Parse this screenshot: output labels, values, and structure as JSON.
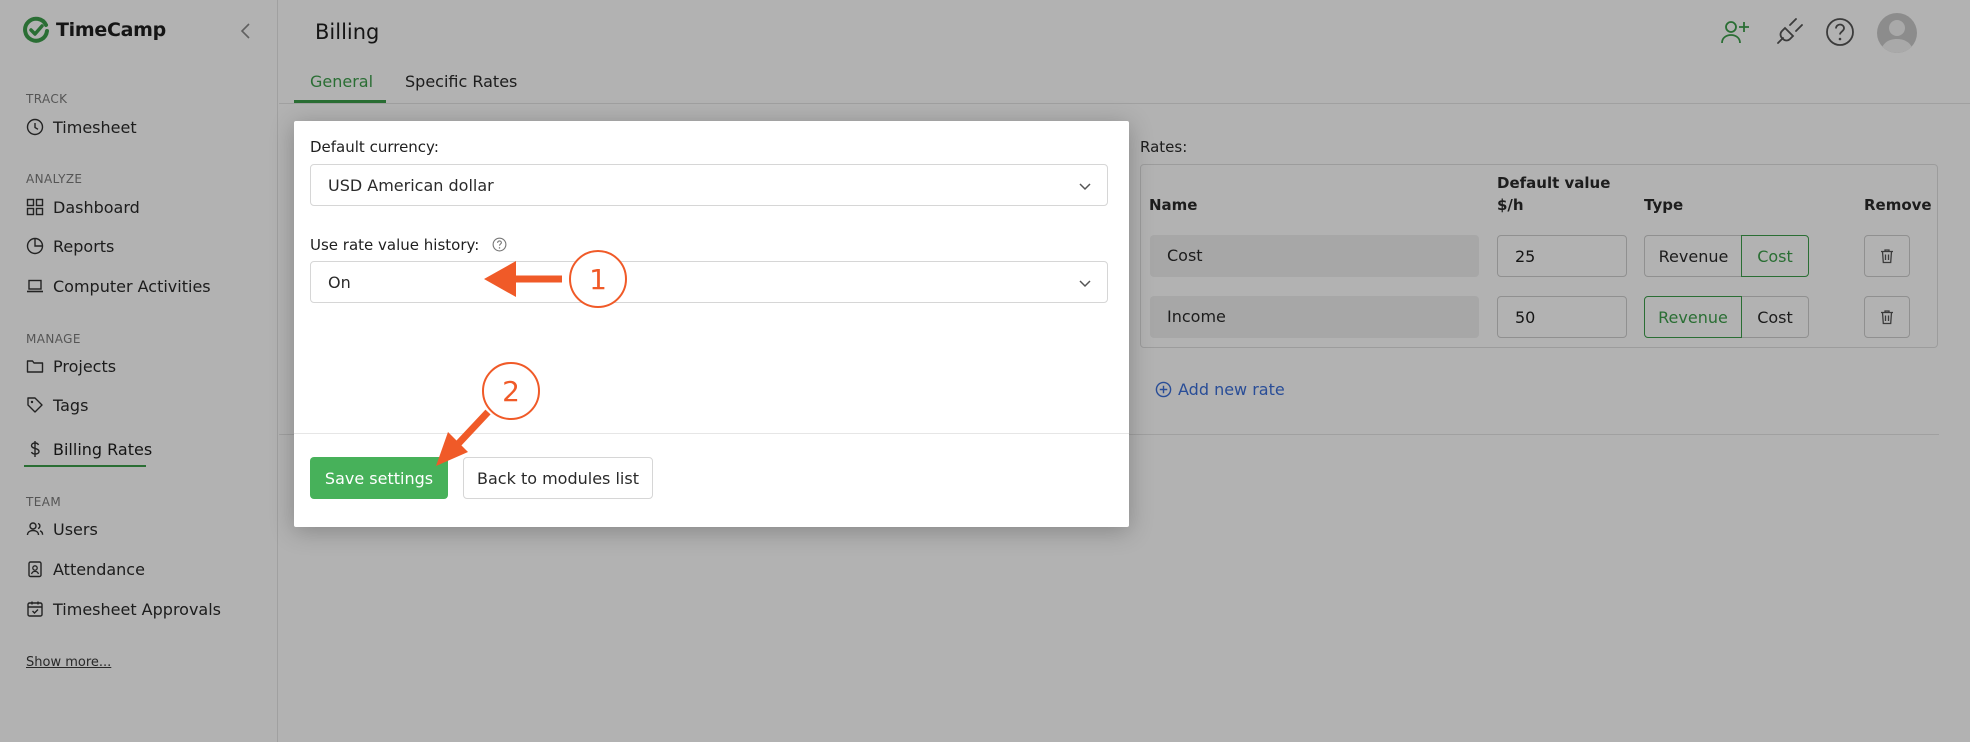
{
  "app": {
    "name": "TimeCamp",
    "brand_color": "#3d9e4b"
  },
  "sidebar": {
    "sections": [
      {
        "title": "TRACK",
        "items": [
          {
            "label": "Timesheet",
            "icon": "clock-icon"
          }
        ]
      },
      {
        "title": "ANALYZE",
        "items": [
          {
            "label": "Dashboard",
            "icon": "dashboard-icon"
          },
          {
            "label": "Reports",
            "icon": "pie-chart-icon"
          },
          {
            "label": "Computer Activities",
            "icon": "laptop-icon"
          }
        ]
      },
      {
        "title": "MANAGE",
        "items": [
          {
            "label": "Projects",
            "icon": "folder-icon"
          },
          {
            "label": "Tags",
            "icon": "tag-icon"
          },
          {
            "label": "Billing Rates",
            "icon": "dollar-icon",
            "active": true
          }
        ]
      },
      {
        "title": "TEAM",
        "items": [
          {
            "label": "Users",
            "icon": "users-icon"
          },
          {
            "label": "Attendance",
            "icon": "badge-icon"
          },
          {
            "label": "Timesheet Approvals",
            "icon": "calendar-check-icon"
          }
        ]
      }
    ],
    "show_more": "Show more..."
  },
  "header": {
    "title": "Billing",
    "tabs": [
      {
        "label": "General",
        "active": true
      },
      {
        "label": "Specific Rates",
        "active": false
      }
    ]
  },
  "rates": {
    "label": "Rates:",
    "columns": {
      "name": "Name",
      "default_value": "Default value",
      "unit": "$/h",
      "type": "Type",
      "remove": "Remove"
    },
    "rows": [
      {
        "name": "Cost",
        "value": "25",
        "type_options": [
          "Revenue",
          "Cost"
        ],
        "selected": "Cost"
      },
      {
        "name": "Income",
        "value": "50",
        "type_options": [
          "Revenue",
          "Cost"
        ],
        "selected": "Revenue"
      }
    ],
    "add_label": "Add new rate"
  },
  "modal": {
    "currency_label": "Default currency:",
    "currency_value": "USD American dollar",
    "history_label": "Use rate value history:",
    "history_value": "On",
    "save_label": "Save settings",
    "back_label": "Back to modules list"
  },
  "annotations": {
    "color": "#f05a28",
    "badges": [
      "1",
      "2"
    ]
  }
}
